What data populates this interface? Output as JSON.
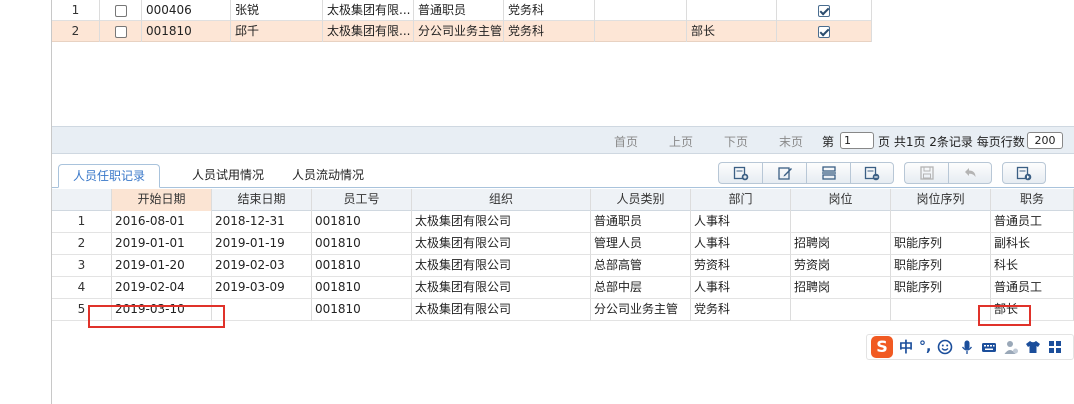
{
  "top_grid": {
    "rows": [
      {
        "num": "1",
        "code": "000406",
        "name": "张锐",
        "org": "太极集团有限...",
        "type": "普通职员",
        "dept": "党务科",
        "col7": "",
        "title": "",
        "checked": true
      },
      {
        "num": "2",
        "code": "001810",
        "name": "邱千",
        "org": "太极集团有限...",
        "type": "分公司业务主管",
        "dept": "党务科",
        "col7": "",
        "title": "部长",
        "checked": true
      }
    ]
  },
  "pager": {
    "first": "首页",
    "prev": "上页",
    "next": "下页",
    "last": "末页",
    "page_prefix": "第",
    "page_value": "1",
    "page_suffix": "页 共1页 2条记录 每页行数",
    "rows_per_page": "200"
  },
  "tabs": [
    {
      "label": "人员任职记录"
    },
    {
      "label": "人员试用情况"
    },
    {
      "label": "人员流动情况"
    }
  ],
  "toolbar": {
    "icons": [
      "add-record-icon",
      "edit-icon",
      "insert-row-icon",
      "delete-row-icon",
      "save-icon",
      "undo-icon",
      "export-icon"
    ]
  },
  "grid": {
    "headers": [
      "",
      "开始日期",
      "结束日期",
      "员工号",
      "组织",
      "人员类别",
      "部门",
      "岗位",
      "岗位序列",
      "职务"
    ],
    "rows": [
      [
        "1",
        "2016-08-01",
        "2018-12-31",
        "001810",
        "太极集团有限公司",
        "普通职员",
        "人事科",
        "",
        "",
        "普通员工"
      ],
      [
        "2",
        "2019-01-01",
        "2019-01-19",
        "001810",
        "太极集团有限公司",
        "管理人员",
        "人事科",
        "招聘岗",
        "职能序列",
        "副科长"
      ],
      [
        "3",
        "2019-01-20",
        "2019-02-03",
        "001810",
        "太极集团有限公司",
        "总部高管",
        "劳资科",
        "劳资岗",
        "职能序列",
        "科长"
      ],
      [
        "4",
        "2019-02-04",
        "2019-03-09",
        "001810",
        "太极集团有限公司",
        "总部中层",
        "人事科",
        "招聘岗",
        "职能序列",
        "普通员工"
      ],
      [
        "5",
        "2019-03-10",
        "",
        "001810",
        "太极集团有限公司",
        "分公司业务主管",
        "党务科",
        "",
        "",
        "部长"
      ]
    ]
  },
  "ime": {
    "logo": "S",
    "mode": "中",
    "punct": "°,"
  },
  "colors": {
    "accent": "#3a78c9",
    "highlight_row": "#fde6d6",
    "annotation_red": "#e0322a"
  }
}
